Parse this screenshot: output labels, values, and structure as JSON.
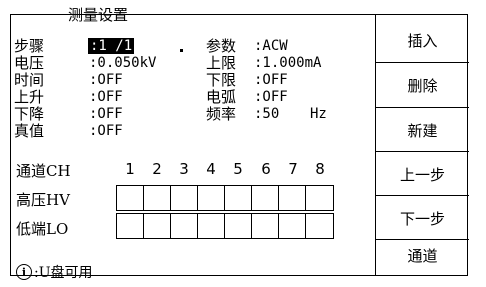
{
  "panel_title": "测量设置",
  "left_fields": [
    {
      "label": "步骤",
      "value": ":1 /1",
      "selected": true
    },
    {
      "label": "电压",
      "value": ":0.050kV"
    },
    {
      "label": "时间",
      "value": ":OFF"
    },
    {
      "label": "上升",
      "value": ":OFF"
    },
    {
      "label": "下降",
      "value": ":OFF"
    },
    {
      "label": "真值",
      "value": ":OFF"
    }
  ],
  "right_fields": [
    {
      "label": "参数",
      "value": ":ACW"
    },
    {
      "label": "上限",
      "value": ":1.000mA"
    },
    {
      "label": "下限",
      "value": ":OFF"
    },
    {
      "label": "电弧",
      "value": ":OFF"
    },
    {
      "label": "频率",
      "value": ":50",
      "unit": "Hz"
    }
  ],
  "channel": {
    "label": "通道CH",
    "numbers": [
      "1",
      "2",
      "3",
      "4",
      "5",
      "6",
      "7",
      "8"
    ],
    "high_label": "高压HV",
    "low_label": "低端LO"
  },
  "sidebar": {
    "buttons": [
      "插入",
      "删除",
      "新建",
      "上一步",
      "下一步",
      "通道"
    ]
  },
  "status": {
    "icon": "info-icon",
    "icon_glyph": "i",
    "text": ":U盘可用"
  }
}
